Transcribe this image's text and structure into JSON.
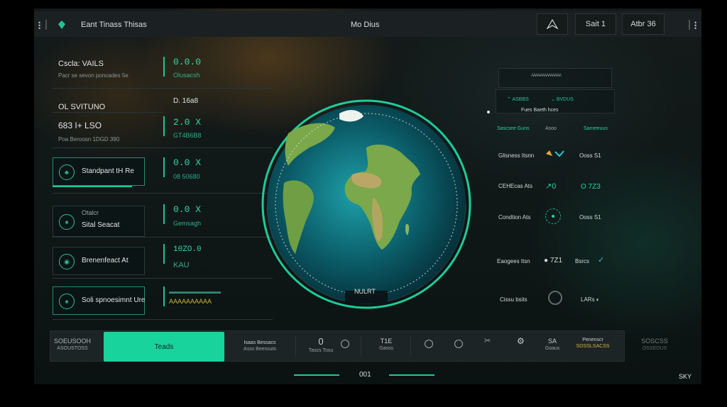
{
  "topbar": {
    "logo_icon": "leaf-icon",
    "title": "Eant Tinass Thisas",
    "center_text": "Mo Dius",
    "nav_icon": "navigation-arrow-icon",
    "button1": "Sait 1",
    "button2": "Atbr 36"
  },
  "left_panel": {
    "header_title": "Cscla: VAILS",
    "header_sub": "Pacr se sevon poncades 5e",
    "header_value": "0.0.0",
    "header_value_sub": "Olusacsh",
    "section_title": "OL SVITUNO",
    "section_value": "D. 16a8",
    "stat_title": "683 I+ LSO",
    "stat_sub": "Poa Beroosn 1DGD 390",
    "stat_value": "2.0 X",
    "stat_value_sub": "GT4B6B8",
    "rows": [
      {
        "icon": "tree-icon",
        "label": "Standpant tH Re",
        "value": "0.0 X",
        "value_sub": "08 50680"
      },
      {
        "icon": "leaf-icon",
        "label": "Otalcr",
        "label2": "Sital Seacat",
        "value": "0.0 X",
        "value_sub": "Gemsagh"
      },
      {
        "icon": "globe-icon",
        "label": "Brenenfeact At",
        "value": "10ZO.0",
        "value_sub": "KAU"
      },
      {
        "icon": "leaf-icon",
        "label": "Soli spnoesimnt Ure",
        "value": "",
        "value_sub": "AAAAAAAAAA"
      }
    ]
  },
  "globe": {
    "label": "NULRT"
  },
  "right_panel": {
    "top_label": "AAAAAAAAAAAAAA",
    "box_left": "ASBBS",
    "box_right": "BVDUS",
    "box_sub": "Fues Baeth hces",
    "tabs": [
      "Sascsee Guns",
      "Asoo",
      "Sanreeuus"
    ],
    "rows": [
      {
        "label": "Glisness Itsnn",
        "value": "Ooss S1"
      },
      {
        "label": "CEHEcas Ats",
        "value": "O 7Z3"
      },
      {
        "label": "Condtion Ats",
        "value": "Ooss S1"
      },
      {
        "label": "Eaogees Itsn",
        "value": "7Z1",
        "value2": "Bsrcs"
      },
      {
        "label": "Cissu bsits",
        "value": "LARs"
      }
    ]
  },
  "bottom_bar": {
    "left_top": "SOEUSOOH",
    "left_bot": "ASOUSTOSS",
    "active_button": "Teads",
    "items": [
      {
        "top": "Isaas Bessacs",
        "bot": "Asss Beessuts"
      },
      {
        "top": "0",
        "bot": "Tascs Tosu"
      },
      {
        "top": "T1E",
        "bot": "Gasss"
      },
      {
        "top": "SA",
        "bot": "Goaus"
      },
      {
        "top": "Penenscr",
        "bot": "SOSSLSACSS"
      }
    ],
    "right_top": "SOSCSS",
    "right_bot": "OSSEOUS",
    "page": "001",
    "corner": "SKY"
  }
}
